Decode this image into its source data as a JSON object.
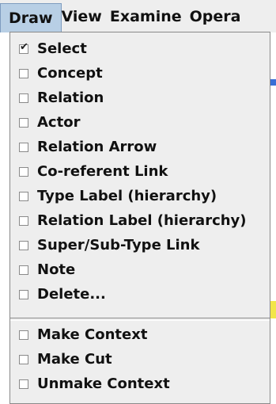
{
  "menubar": {
    "items": [
      "Draw",
      "View",
      "Examine",
      "Opera"
    ],
    "active_index": 0
  },
  "dropdown": {
    "items": [
      {
        "label": "Select",
        "checked": true
      },
      {
        "label": "Concept",
        "checked": false
      },
      {
        "label": "Relation",
        "checked": false
      },
      {
        "label": "Actor",
        "checked": false
      },
      {
        "label": "Relation Arrow",
        "checked": false
      },
      {
        "label": "Co-referent Link",
        "checked": false
      },
      {
        "label": "Type Label (hierarchy)",
        "checked": false
      },
      {
        "label": "Relation Label (hierarchy)",
        "checked": false
      },
      {
        "label": "Super/Sub-Type Link",
        "checked": false
      },
      {
        "label": "Note",
        "checked": false
      },
      {
        "label": "Delete...",
        "checked": false
      },
      {
        "label": "Make Context",
        "checked": false
      },
      {
        "label": "Make Cut",
        "checked": false
      },
      {
        "label": "Unmake Context",
        "checked": false
      }
    ]
  },
  "colors": {
    "menubar_bg": "#eeeeee",
    "active_bg": "#b8cfe5",
    "dropdown_bg": "#eeeeee",
    "behind_blue": "#3a6fd6",
    "behind_yellow": "#f2e64a"
  }
}
